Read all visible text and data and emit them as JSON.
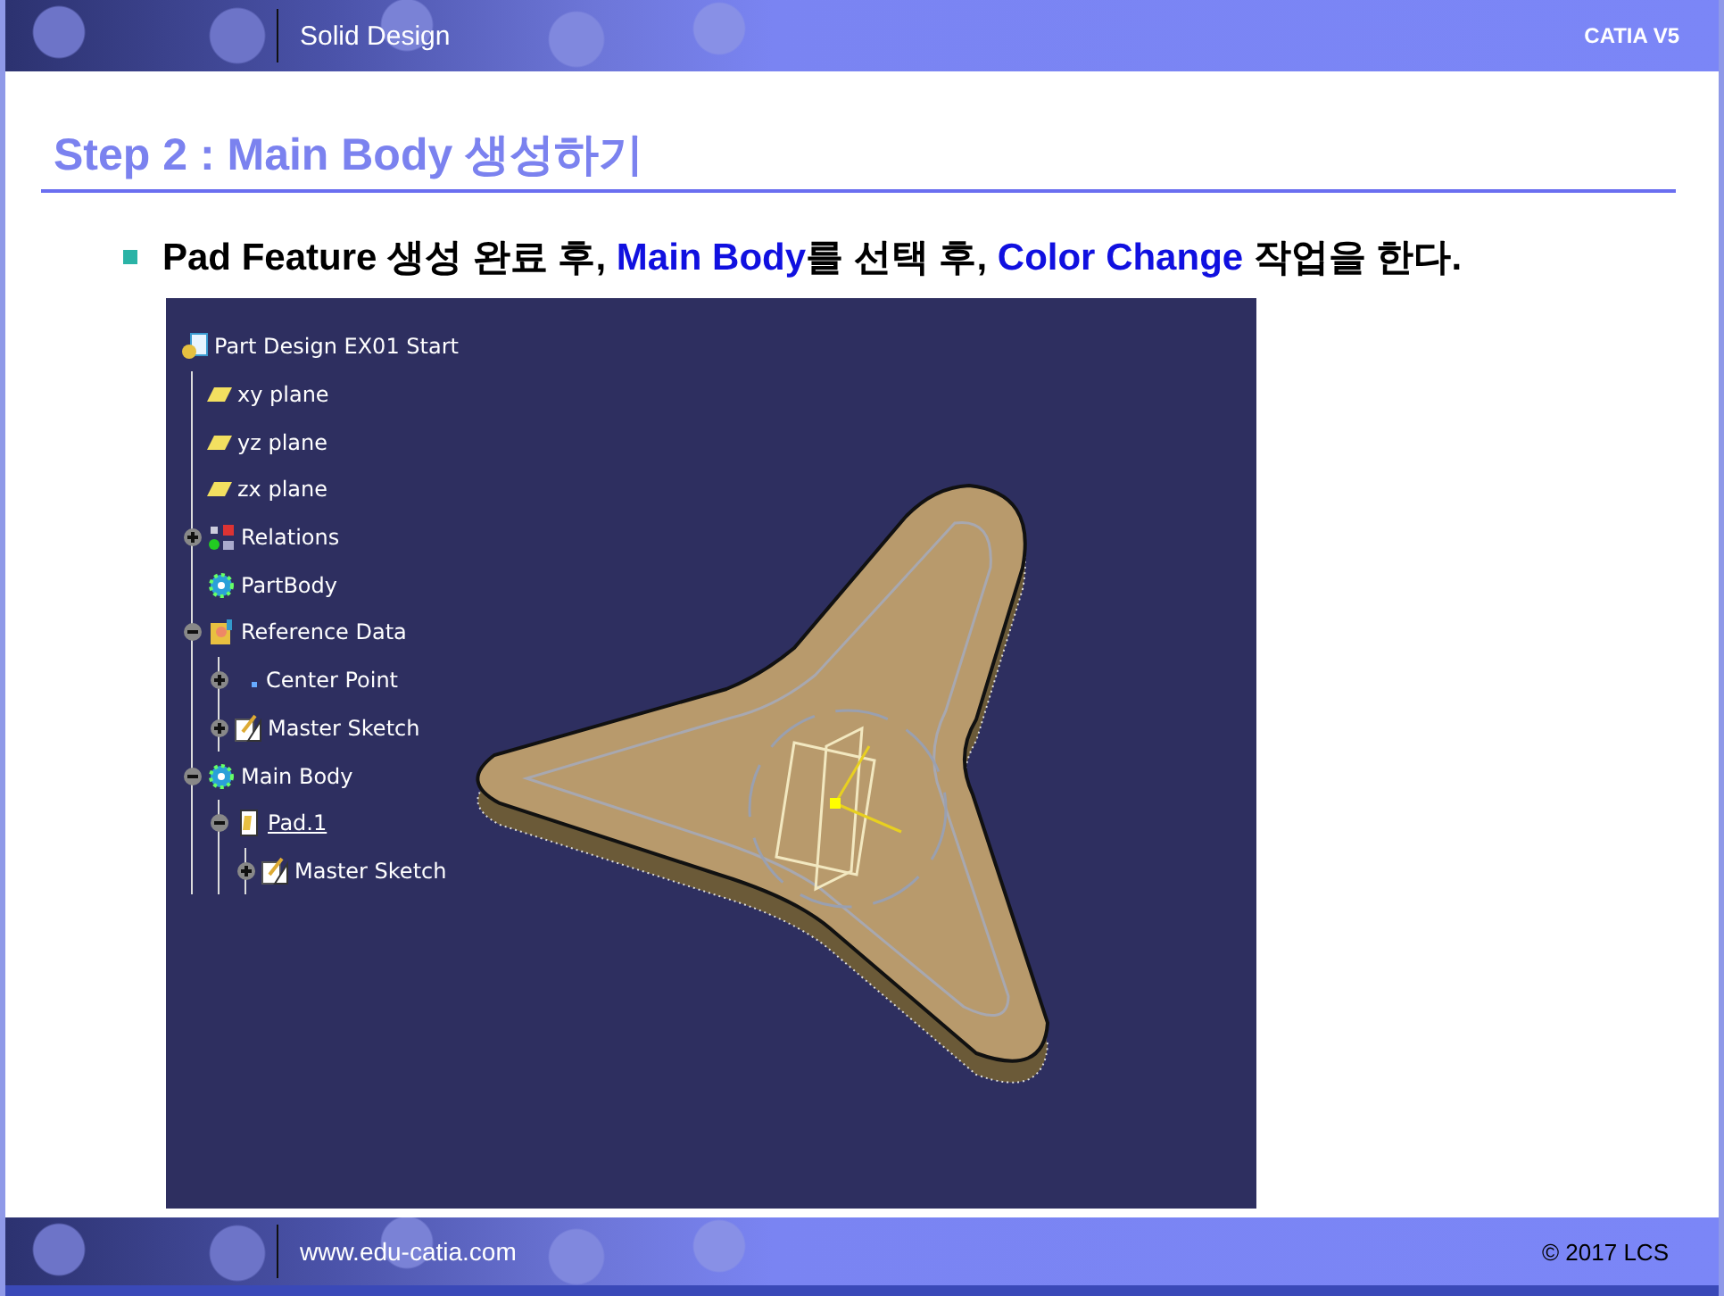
{
  "header": {
    "section": "Solid Design",
    "product": "CATIA V5"
  },
  "title": "Step 2 : Main Body 생성하기",
  "bullet": [
    {
      "text": "Pad Feature ",
      "highlight": false
    },
    {
      "text": "생성 완료 후, ",
      "highlight": false
    },
    {
      "text": "Main Body",
      "highlight": true
    },
    {
      "text": "를 선택 후, ",
      "highlight": false
    },
    {
      "text": "Color Change",
      "highlight": true
    },
    {
      "text": " 작업을 한다.",
      "highlight": false
    }
  ],
  "tree": {
    "label": "Part Design EX01 Start",
    "kind": "document",
    "current": false,
    "children": [
      {
        "label": "xy plane",
        "kind": "plane",
        "current": false
      },
      {
        "label": "yz plane",
        "kind": "plane",
        "current": false
      },
      {
        "label": "zx plane",
        "kind": "plane",
        "current": false
      },
      {
        "label": "Relations",
        "kind": "relations",
        "current": false,
        "expanded": false
      },
      {
        "label": "PartBody",
        "kind": "body",
        "current": false
      },
      {
        "label": "Reference Data",
        "kind": "reference",
        "current": false,
        "expanded": true,
        "children": [
          {
            "label": "Center Point",
            "kind": "point",
            "current": false,
            "expanded": false
          },
          {
            "label": "Master Sketch",
            "kind": "sketch",
            "current": false,
            "expanded": false
          }
        ]
      },
      {
        "label": "Main Body",
        "kind": "body",
        "current": false,
        "expanded": true,
        "children": [
          {
            "label": "Pad.1",
            "kind": "pad",
            "current": true,
            "expanded": true,
            "children": [
              {
                "label": "Master Sketch",
                "kind": "sketch",
                "current": false,
                "expanded": false
              }
            ]
          }
        ]
      }
    ]
  },
  "footer": {
    "site": "www.edu-catia.com",
    "copyright": "© 2017 LCS"
  }
}
